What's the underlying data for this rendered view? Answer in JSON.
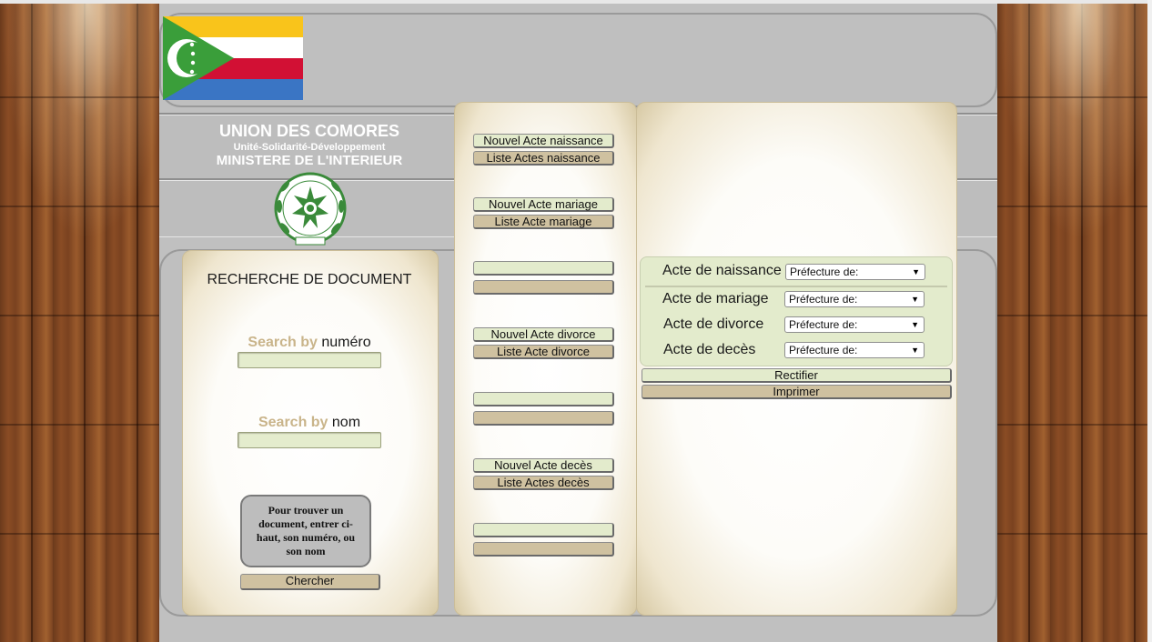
{
  "header": {
    "title": "UNION DES COMORES",
    "motto": "Unité-Solidarité-Développement",
    "ministry": "MINISTERE DE L'INTERIEUR"
  },
  "colors": {
    "flag_yellow": "#f9c41b",
    "flag_white": "#ffffff",
    "flag_red": "#d21034",
    "flag_blue": "#3a75c4",
    "flag_green": "#3a9e3a",
    "button_green": "#e3ebcc",
    "button_tan": "#cfc1a0",
    "page_gray": "#c0c0c0"
  },
  "search": {
    "title": "RECHERCHE DE DOCUMENT",
    "by_prefix": "Search by",
    "numero_label": "numéro",
    "nom_label": "nom",
    "numero_value": "",
    "nom_value": "",
    "hint": "Pour trouver un document, entrer ci-haut, son numéro, ou son nom",
    "submit_label": "Chercher"
  },
  "actes": {
    "naissance_new": "Nouvel Acte naissance",
    "naissance_list": "Liste Actes naissance",
    "mariage_new": "Nouvel Acte mariage",
    "mariage_list": "Liste Acte mariage",
    "blank1_a": "",
    "blank1_b": "",
    "divorce_new": "Nouvel Acte divorce",
    "divorce_list": "Liste Acte divorce",
    "blank2_a": "",
    "blank2_b": "",
    "deces_new": "Nouvel Acte decès",
    "deces_list": "Liste Actes  decès",
    "blank3_a": "",
    "blank3_b": ""
  },
  "form": {
    "naissance_label": "Acte de naissance",
    "mariage_label": "Acte de mariage",
    "divorce_label": "Acte de divorce",
    "deces_label": "Acte de decès",
    "prefecture_naissance": "Préfecture de:",
    "prefecture_mariage": "Préfecture de:",
    "prefecture_divorce": "Préfecture de:",
    "prefecture_deces": "Préfecture de:",
    "rectifier_label": "Rectifier",
    "imprimer_label": "Imprimer"
  }
}
